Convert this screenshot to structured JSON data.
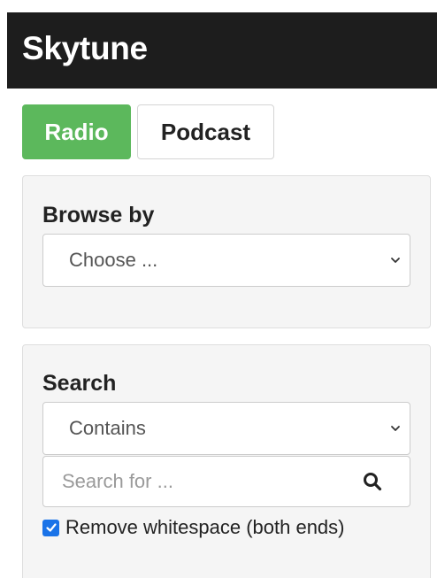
{
  "header": {
    "title": "Skytune"
  },
  "tabs": [
    {
      "label": "Radio",
      "active": true
    },
    {
      "label": "Podcast",
      "active": false
    }
  ],
  "browse": {
    "heading": "Browse by",
    "select_value": "Choose ..."
  },
  "search": {
    "heading": "Search",
    "mode_value": "Contains",
    "placeholder": "Search for ...",
    "trim_label": "Remove whitespace (both ends)",
    "trim_checked": true
  },
  "colors": {
    "header_bg": "#1d1d1d",
    "active_tab": "#5cb85c",
    "checkbox": "#1a73e8"
  }
}
